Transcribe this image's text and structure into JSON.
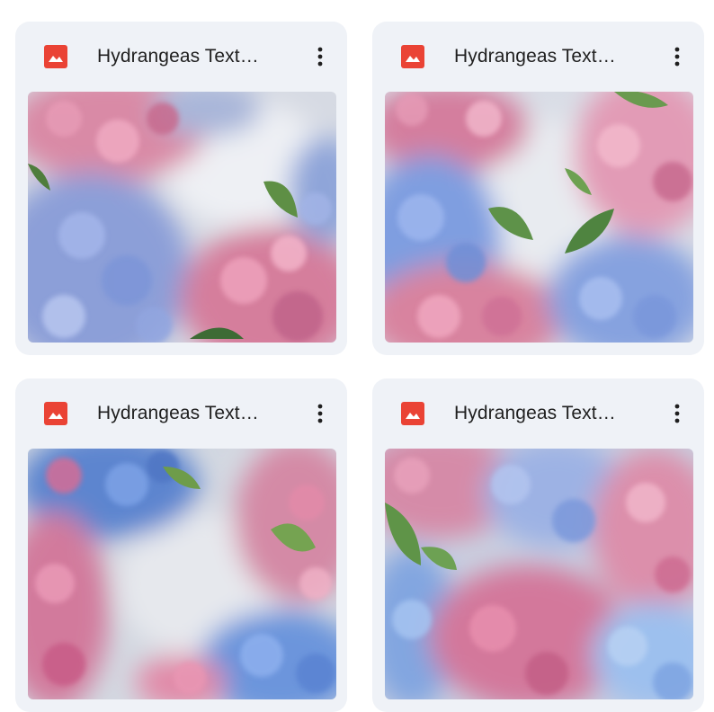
{
  "files": [
    {
      "title": "Hydrangeas Text…",
      "type_icon": "image-file-icon",
      "menu_icon": "more-vert-icon"
    },
    {
      "title": "Hydrangeas Text…",
      "type_icon": "image-file-icon",
      "menu_icon": "more-vert-icon"
    },
    {
      "title": "Hydrangeas Text…",
      "type_icon": "image-file-icon",
      "menu_icon": "more-vert-icon"
    },
    {
      "title": "Hydrangeas Text…",
      "type_icon": "image-file-icon",
      "menu_icon": "more-vert-icon"
    }
  ],
  "colors": {
    "card_background": "#eff2f7",
    "image_icon": "#ea4335",
    "title_text": "#1f1f1f",
    "pink": "#d9849f",
    "blue": "#7f9fdc",
    "leaf": "#5e8f45",
    "mist": "#d8dde6"
  }
}
